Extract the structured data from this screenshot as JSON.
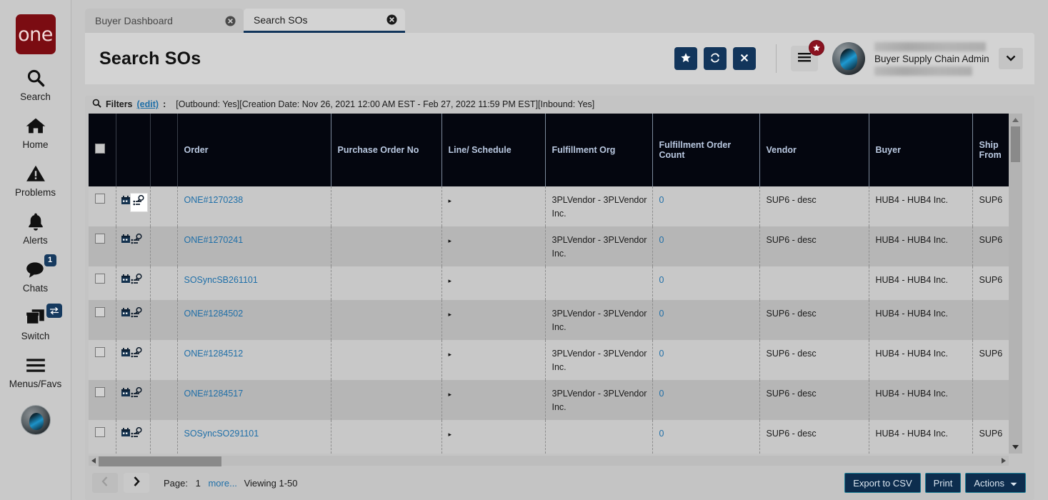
{
  "brand": {
    "logo_text": "one",
    "logo_color": "#7b0c12"
  },
  "sidebar": {
    "items": [
      {
        "label": "Search",
        "icon": "search-icon"
      },
      {
        "label": "Home",
        "icon": "home-icon"
      },
      {
        "label": "Problems",
        "icon": "warning-triangle-icon"
      },
      {
        "label": "Alerts",
        "icon": "bell-icon"
      },
      {
        "label": "Chats",
        "icon": "chat-bubble-icon",
        "badge": "1"
      },
      {
        "label": "Switch",
        "icon": "windows-stack-icon",
        "badge_icon": "swap-arrows-icon"
      },
      {
        "label": "Menus/Favs",
        "icon": "hamburger-icon"
      }
    ]
  },
  "tabs": [
    {
      "label": "Buyer Dashboard",
      "active": false
    },
    {
      "label": "Search SOs",
      "active": true
    }
  ],
  "header": {
    "title": "Search SOs",
    "buttons": [
      {
        "name": "favorite-button",
        "icon": "star-icon"
      },
      {
        "name": "refresh-button",
        "icon": "refresh-icon"
      },
      {
        "name": "close-button",
        "icon": "x-icon"
      }
    ],
    "menu_icon": "hamburger-icon",
    "menu_badge_icon": "star-icon",
    "user_role": "Buyer Supply Chain Admin",
    "caret_icon": "chevron-down-icon"
  },
  "filters": {
    "icon": "search-icon",
    "label": "Filters",
    "edit_link": "(edit)",
    "colon": ":",
    "text": "[Outbound: Yes][Creation Date: Nov 26, 2021 12:00 AM EST - Feb 27, 2022 11:59 PM EST][Inbound: Yes]"
  },
  "table": {
    "columns": [
      "",
      "",
      "",
      "Order",
      "Purchase Order No",
      "Line/ Schedule",
      "Fulfillment Org",
      "Fulfillment Order Count",
      "Vendor",
      "Buyer",
      "Ship From"
    ],
    "rows": [
      {
        "order": "ONE#1270238",
        "po": "",
        "line": "",
        "ffo": "3PLVendor - 3PLVendor Inc.",
        "ffo_count": "0",
        "vendor": "SUP6 - desc",
        "buyer": "HUB4 - HUB4 Inc.",
        "ship_from": "SUP6"
      },
      {
        "order": "ONE#1270241",
        "po": "",
        "line": "",
        "ffo": "3PLVendor - 3PLVendor Inc.",
        "ffo_count": "0",
        "vendor": "SUP6 - desc",
        "buyer": "HUB4 - HUB4 Inc.",
        "ship_from": "SUP6"
      },
      {
        "order": "SOSyncSB261101",
        "po": "",
        "line": "",
        "ffo": "",
        "ffo_count": "0",
        "vendor": "",
        "buyer": "HUB4 - HUB4 Inc.",
        "ship_from": "SUP6"
      },
      {
        "order": "ONE#1284502",
        "po": "",
        "line": "",
        "ffo": "3PLVendor - 3PLVendor Inc.",
        "ffo_count": "0",
        "vendor": "SUP6 - desc",
        "buyer": "HUB4 - HUB4 Inc.",
        "ship_from": ""
      },
      {
        "order": "ONE#1284512",
        "po": "",
        "line": "",
        "ffo": "3PLVendor - 3PLVendor Inc.",
        "ffo_count": "0",
        "vendor": "SUP6 - desc",
        "buyer": "HUB4 - HUB4 Inc.",
        "ship_from": "SUP6"
      },
      {
        "order": "ONE#1284517",
        "po": "",
        "line": "",
        "ffo": "3PLVendor - 3PLVendor Inc.",
        "ffo_count": "0",
        "vendor": "SUP6 - desc",
        "buyer": "HUB4 - HUB4 Inc.",
        "ship_from": ""
      },
      {
        "order": "SOSyncSO291101",
        "po": "",
        "line": "",
        "ffo": "",
        "ffo_count": "0",
        "vendor": "SUP6 - desc",
        "buyer": "HUB4 - HUB4 Inc.",
        "ship_from": "SUP6"
      }
    ]
  },
  "footer": {
    "prev_icon": "chevron-left-icon",
    "next_icon": "chevron-right-icon",
    "page_label": "Page:",
    "page_number": "1",
    "more_label": "more...",
    "viewing_label": "Viewing 1-50",
    "export_label": "Export to CSV",
    "print_label": "Print",
    "actions_label": "Actions"
  }
}
